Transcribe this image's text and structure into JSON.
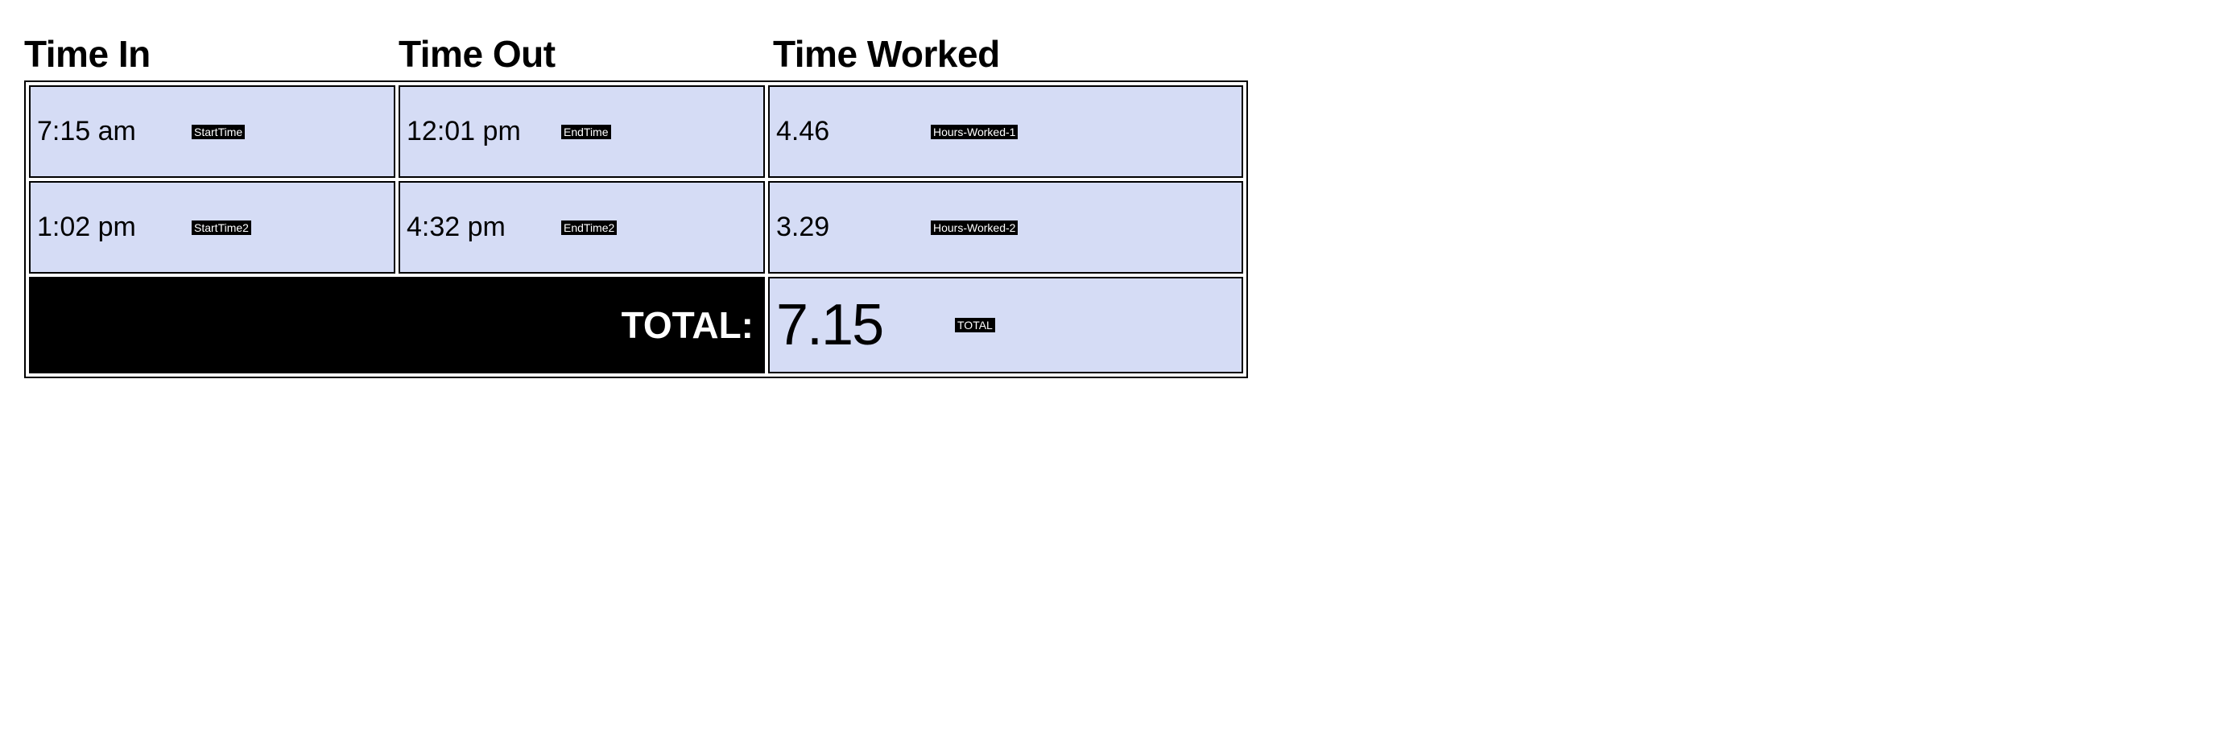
{
  "headers": {
    "time_in": "Time In",
    "time_out": "Time Out",
    "time_worked": "Time Worked"
  },
  "rows": [
    {
      "in_value": "7:15 am",
      "in_tag": "StartTime",
      "out_value": "12:01 pm",
      "out_tag": "EndTime",
      "worked_value": "4.46",
      "worked_tag": "Hours-Worked-1"
    },
    {
      "in_value": "1:02 pm",
      "in_tag": "StartTime2",
      "out_value": "4:32 pm",
      "out_tag": "EndTime2",
      "worked_value": "3.29",
      "worked_tag": "Hours-Worked-2"
    }
  ],
  "total": {
    "label": "TOTAL:",
    "value": "7.15",
    "tag": "TOTAL"
  }
}
